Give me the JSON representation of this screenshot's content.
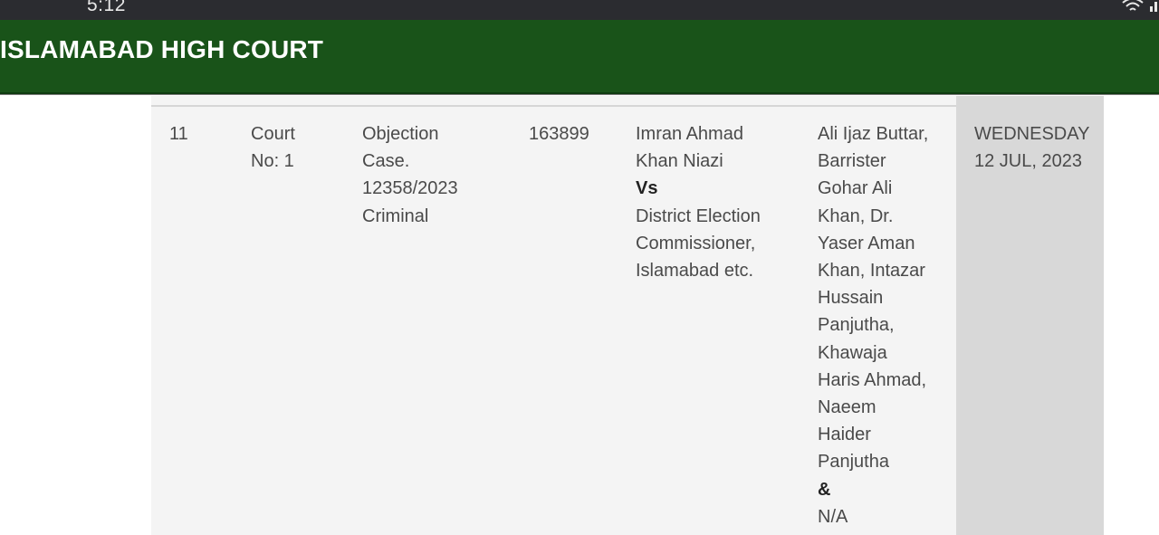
{
  "status_bar": {
    "time": "5:12",
    "icons": [
      "wifi-icon",
      "signal-icon"
    ]
  },
  "header": {
    "title": "ISLAMABAD HIGH COURT",
    "background_color": "#195319"
  },
  "row": {
    "serial": "11",
    "court": [
      "Court",
      "No: 1"
    ],
    "case": [
      "Objection",
      "Case.",
      "12358/2023",
      "Criminal"
    ],
    "case_id": "163899",
    "parties": {
      "petitioner": [
        "Imran Ahmad",
        "Khan Niazi"
      ],
      "versus": "Vs",
      "respondent": [
        "District Election",
        "Commissioner,",
        "Islamabad etc."
      ]
    },
    "counsel": {
      "names": [
        "Ali Ijaz Buttar,",
        "Barrister",
        "Gohar Ali",
        "Khan, Dr.",
        "Yaser Aman",
        "Khan, Intazar",
        "Hussain",
        "Panjutha,",
        "Khawaja",
        "Haris Ahmad,",
        "Naeem",
        "Haider",
        "Panjutha"
      ],
      "ampersand": "&",
      "other": "N/A"
    },
    "date": [
      "WEDNESDAY",
      "12 JUL, 2023"
    ]
  }
}
